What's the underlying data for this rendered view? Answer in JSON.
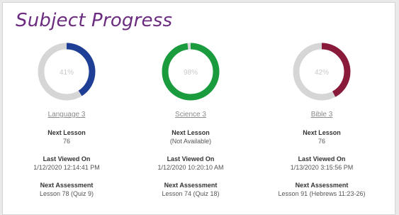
{
  "title": "Subject Progress",
  "colors": {
    "title": "#6b2c7f",
    "track": "#d6d6d6",
    "language": "#1f3f96",
    "science": "#1a9b3e",
    "bible": "#8a1a3a"
  },
  "labels": {
    "next_lesson": "Next Lesson",
    "last_viewed": "Last Viewed On",
    "next_assessment": "Next Assessment"
  },
  "subjects": [
    {
      "name": "Language 3",
      "percent_text": "41%",
      "progress": 0.41,
      "next_lesson": "76",
      "last_viewed": "1/12/2020 12:14:41 PM",
      "next_assessment": "Lesson 78 (Quiz 9)"
    },
    {
      "name": "Science 3",
      "percent_text": "98%",
      "progress": 0.98,
      "next_lesson": "(Not Available)",
      "last_viewed": "1/12/2020 10:20:10 AM",
      "next_assessment": "Lesson 74 (Quiz 18)"
    },
    {
      "name": "Bible 3",
      "percent_text": "42%",
      "progress": 0.42,
      "next_lesson": "76",
      "last_viewed": "1/13/2020 3:15:56 PM",
      "next_assessment": "Lesson 91 (Hebrews 11:23-26)"
    }
  ]
}
